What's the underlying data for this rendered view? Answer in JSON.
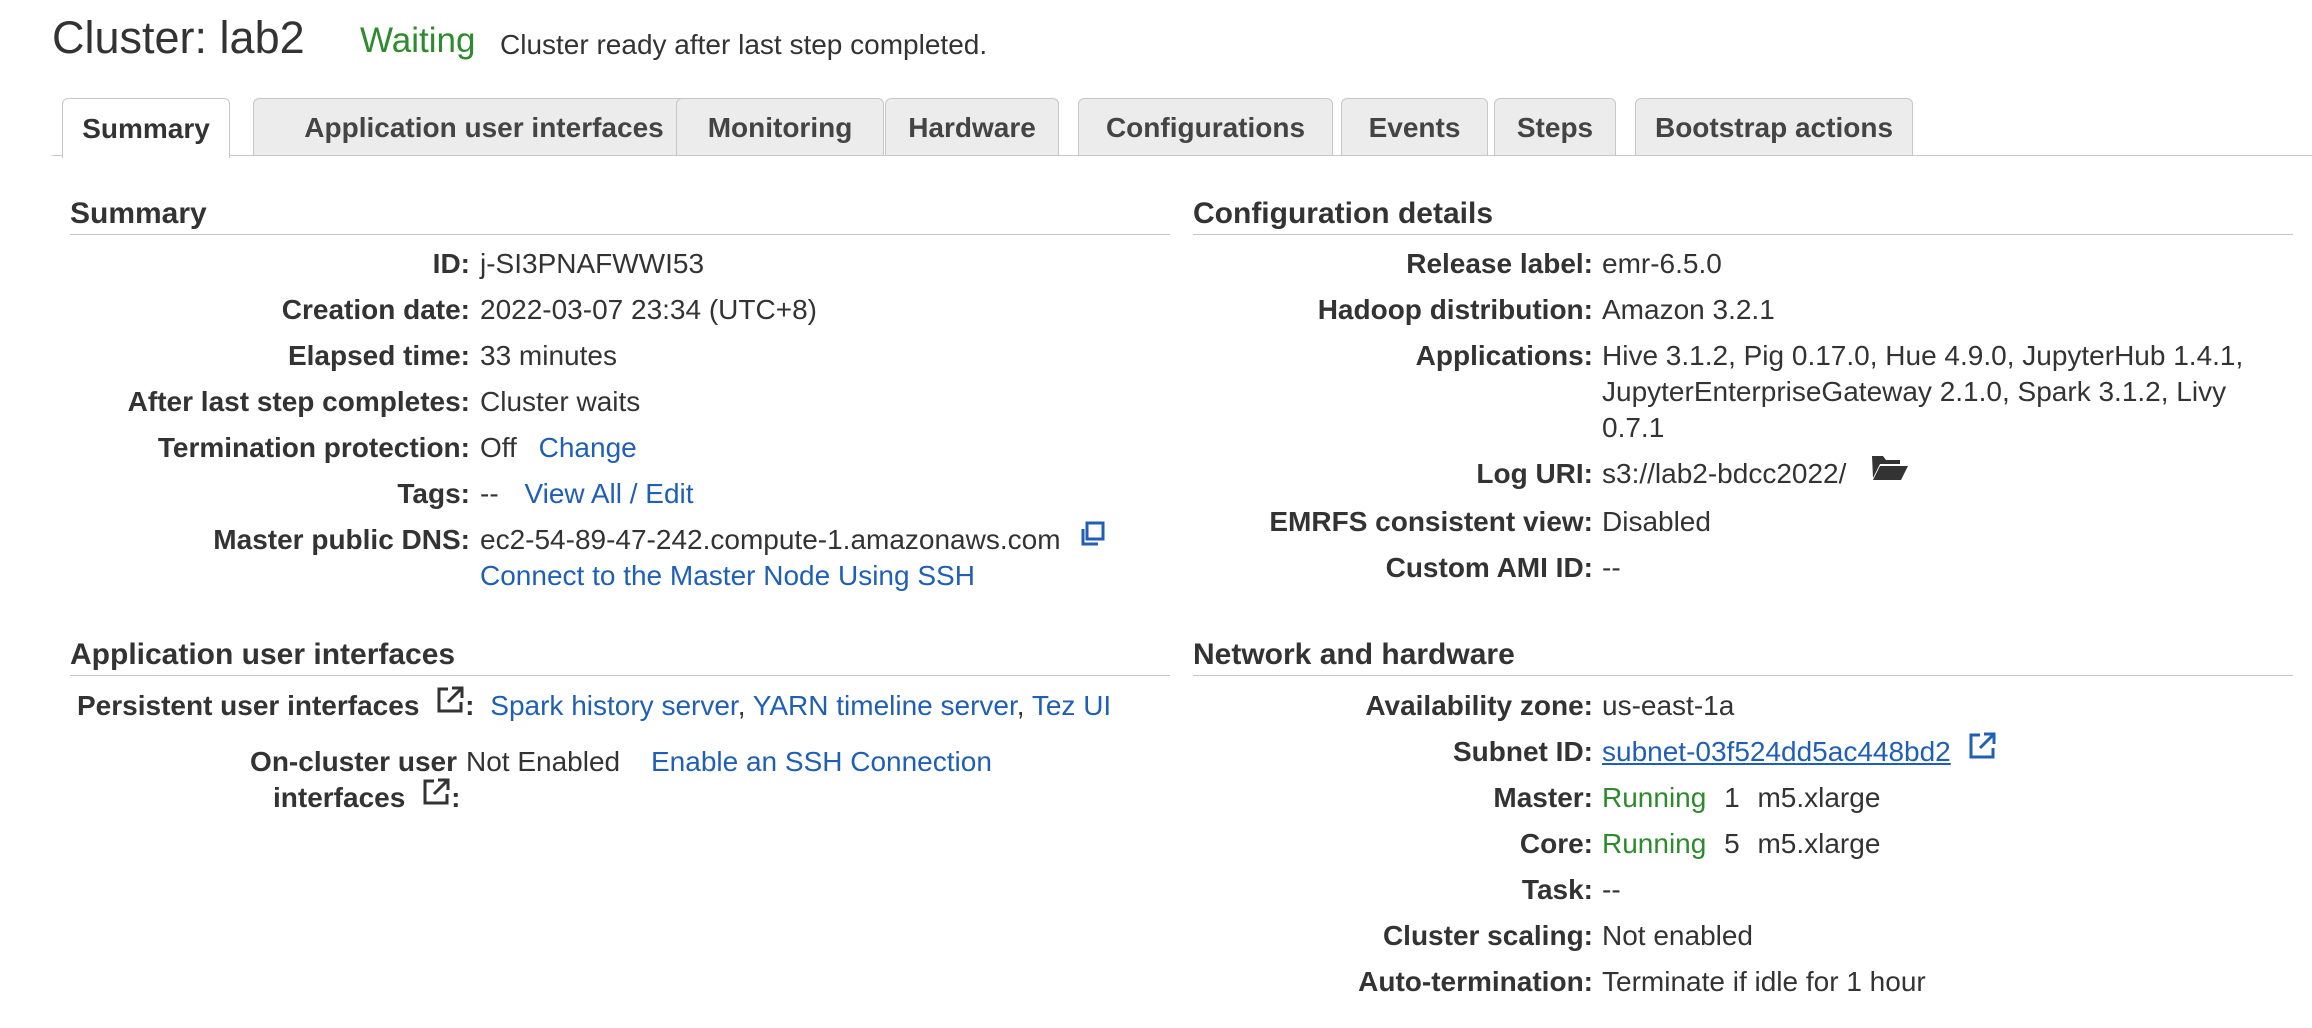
{
  "header": {
    "title": "Cluster: lab2",
    "status": "Waiting",
    "status_message": "Cluster ready after last step completed."
  },
  "tabs": [
    {
      "label": "Summary",
      "active": true
    },
    {
      "label": "Application user interfaces",
      "active": false
    },
    {
      "label": "Monitoring",
      "active": false
    },
    {
      "label": "Hardware",
      "active": false
    },
    {
      "label": "Configurations",
      "active": false
    },
    {
      "label": "Events",
      "active": false
    },
    {
      "label": "Steps",
      "active": false
    },
    {
      "label": "Bootstrap actions",
      "active": false
    }
  ],
  "summary": {
    "title": "Summary",
    "id_label": "ID:",
    "id_value": "j-SI3PNAFWWI53",
    "creation_label": "Creation date:",
    "creation_value": "2022-03-07 23:34 (UTC+8)",
    "elapsed_label": "Elapsed time:",
    "elapsed_value": "33 minutes",
    "after_step_label": "After last step completes:",
    "after_step_value": "Cluster waits",
    "termination_label": "Termination protection:",
    "termination_value": "Off",
    "termination_change": "Change",
    "tags_label": "Tags:",
    "tags_value": "--",
    "tags_link": "View All / Edit",
    "dns_label": "Master public DNS:",
    "dns_value": "ec2-54-89-47-242.compute-1.amazonaws.com",
    "ssh_link": "Connect to the Master Node Using SSH"
  },
  "config": {
    "title": "Configuration details",
    "release_label": "Release label:",
    "release_value": "emr-6.5.0",
    "hadoop_label": "Hadoop distribution:",
    "hadoop_value": "Amazon 3.2.1",
    "apps_label": "Applications:",
    "apps_line1": "Hive 3.1.2, Pig 0.17.0, Hue 4.9.0, JupyterHub 1.4.1,",
    "apps_line2": "JupyterEnterpriseGateway 2.1.0, Spark 3.1.2, Livy",
    "apps_line3": "0.7.1",
    "log_label": "Log URI:",
    "log_value": "s3://lab2-bdcc2022/",
    "emrfs_label": "EMRFS consistent view:",
    "emrfs_value": "Disabled",
    "ami_label": "Custom AMI ID:",
    "ami_value": "--"
  },
  "app_ui": {
    "title": "Application user interfaces",
    "persistent_label": "Persistent user interfaces",
    "persistent_colon": ":",
    "spark_link": "Spark history server",
    "yarn_link": "YARN timeline server",
    "tez_link": "Tez UI",
    "sep": ",",
    "oncluster_label_line1": "On-cluster user",
    "oncluster_label_line2": "interfaces",
    "oncluster_colon": ":",
    "oncluster_value": "Not Enabled",
    "oncluster_link": "Enable an SSH Connection"
  },
  "network": {
    "title": "Network and hardware",
    "az_label": "Availability zone:",
    "az_value": "us-east-1a",
    "subnet_label": "Subnet ID:",
    "subnet_value": "subnet-03f524dd5ac448bd2",
    "master_label": "Master:",
    "master_status": "Running",
    "master_count": "1",
    "master_type": "m5.xlarge",
    "core_label": "Core:",
    "core_status": "Running",
    "core_count": "5",
    "core_type": "m5.xlarge",
    "task_label": "Task:",
    "task_value": "--",
    "scaling_label": "Cluster scaling:",
    "scaling_value": "Not enabled",
    "autoterm_label": "Auto-termination:",
    "autoterm_value": "Terminate if idle for 1 hour"
  },
  "colors": {
    "status_green": "#2d8a2d",
    "link_blue": "#1f5fb6",
    "tab_inactive": "#ececec"
  },
  "icons": {
    "copy": "copy-icon",
    "external": "external-link-icon",
    "folder": "folder-open-icon"
  }
}
